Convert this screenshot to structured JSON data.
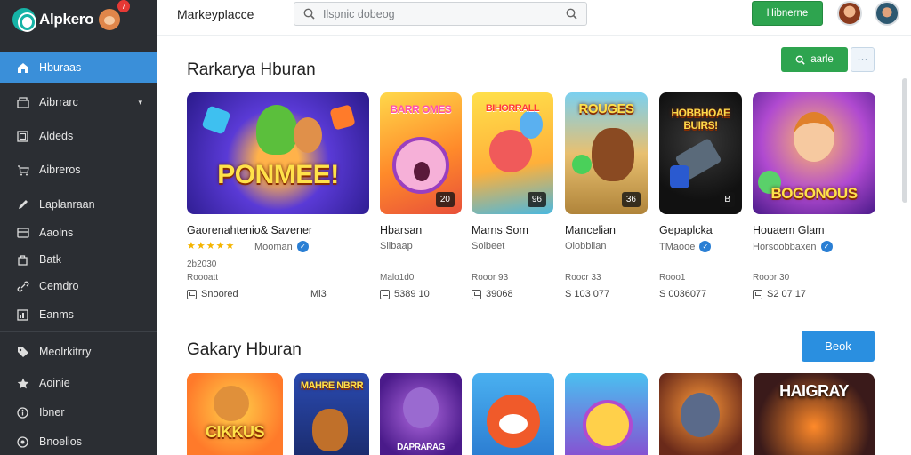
{
  "app": {
    "name": "Alpkero",
    "badge": "7"
  },
  "sidebar": {
    "items": [
      {
        "label": "Hburaas",
        "icon": "home-icon"
      },
      {
        "label": "Aibrrarc",
        "icon": "box-icon",
        "chevron": "▾"
      },
      {
        "label": "Aldeds",
        "icon": "grid-icon"
      },
      {
        "label": "Aibreros",
        "icon": "cart-icon"
      },
      {
        "label": "Laplanraan",
        "icon": "pen-icon"
      },
      {
        "label": "Aaolns",
        "icon": "card-icon"
      },
      {
        "label": "Batk",
        "icon": "bag-icon"
      },
      {
        "label": "Cemdro",
        "icon": "link-icon"
      },
      {
        "label": "Eanms",
        "icon": "chart-icon"
      },
      {
        "label": "Meolrkitrry",
        "icon": "tag-icon"
      },
      {
        "label": "Aoinie",
        "icon": "star-icon"
      },
      {
        "label": "Ibner",
        "icon": "info-icon"
      },
      {
        "label": "Bnoelios",
        "icon": "settings-icon"
      }
    ]
  },
  "topbar": {
    "title": "Markeyplacce",
    "search_placeholder": "Ilspnic dobeog",
    "button": "Hibnerne"
  },
  "section1": {
    "title": "Rarkarya Hburan",
    "primary_button": "aarle",
    "more_button": "⋯",
    "games": [
      {
        "art": "PONMEE!",
        "count": "",
        "name": "Gaorenahtenio& Savener",
        "stars": "★★★★★",
        "dev": "Mooman",
        "verified": true,
        "meta1": "2b2030",
        "meta2": "Roooatt",
        "stat": "Snoored",
        "stat_right": "Mi3"
      },
      {
        "art": "BARR OMES",
        "count": "20",
        "name": "Hbarsan",
        "stars": "",
        "dev": "Slibaap",
        "verified": false,
        "meta1": "",
        "meta2": "Malo1d0",
        "stat": "5389 10",
        "stat_right": ""
      },
      {
        "art": "BIHORRALL",
        "count": "96",
        "name": "Marns Som",
        "stars": "",
        "dev": "Solbeet",
        "verified": false,
        "meta1": "",
        "meta2": "Rooor 93",
        "stat": "39068",
        "stat_right": ""
      },
      {
        "art": "ROUGES",
        "count": "36",
        "name": "Mancelian",
        "stars": "",
        "dev": "Oiobbiian",
        "verified": false,
        "meta1": "",
        "meta2": "Roocr 33",
        "stat": "S 103 077",
        "stat_right": ""
      },
      {
        "art": "HOBBHOAE BUIRS!",
        "count": "B",
        "name": "Gepaplcka",
        "stars": "",
        "dev": "TMaooe",
        "verified": true,
        "meta1": "",
        "meta2": "Rooo1",
        "stat": "S 0036077",
        "stat_right": ""
      },
      {
        "art": "BOGONOUS",
        "count": "",
        "name": "Houaem Glam",
        "stars": "",
        "dev": "Horsoobbaxen",
        "verified": true,
        "meta1": "",
        "meta2": "Rooor 30",
        "stat": "S2 07 17",
        "stat_right": ""
      }
    ]
  },
  "section2": {
    "title": "Gakary Hburan",
    "button": "Beok",
    "games": [
      {
        "art": "CIKKUS"
      },
      {
        "art": "MAHRE NBRR"
      },
      {
        "art": "DAPRARAG"
      },
      {
        "art": ""
      },
      {
        "art": ""
      },
      {
        "art": "HAIGRAY"
      }
    ]
  },
  "colors": {
    "sidebar_bg": "#2b2e33",
    "active": "#3a8fd9",
    "green": "#2ea44f",
    "blue": "#2a8fe0",
    "star": "#f4b400"
  }
}
